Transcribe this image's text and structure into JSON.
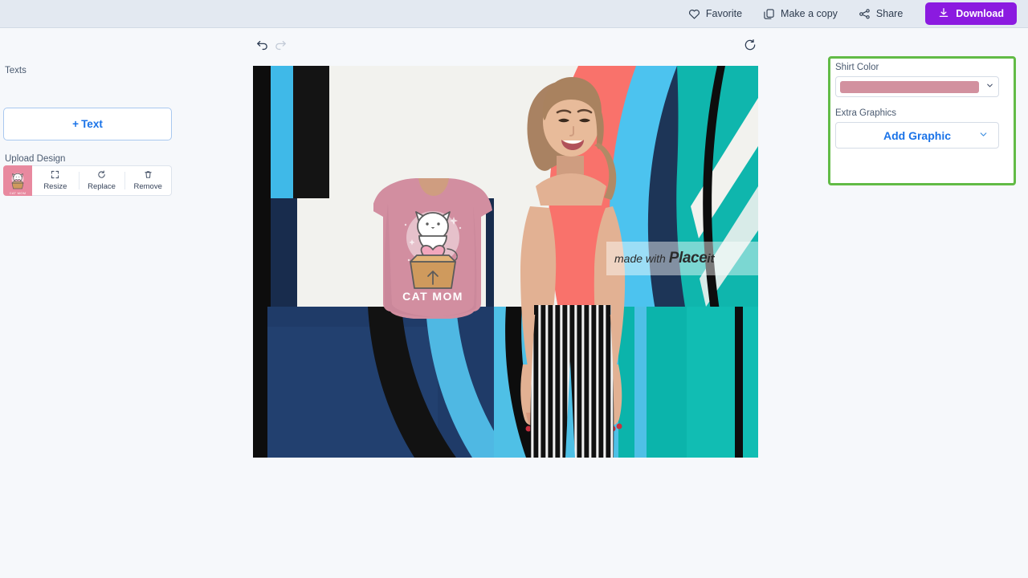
{
  "topbar": {
    "actions": [
      {
        "label": "Favorite",
        "icon": "heart-icon"
      },
      {
        "label": "Make a copy",
        "icon": "copy-icon"
      },
      {
        "label": "Share",
        "icon": "share-icon"
      }
    ],
    "download_label": "Download",
    "download_icon": "download-icon",
    "download_color": "#8b1ae0",
    "background": "#e3e9f1"
  },
  "toolbar": {
    "undo_icon": "undo-icon",
    "redo_icon": "redo-icon",
    "refresh_icon": "refresh-icon",
    "undo_enabled": true,
    "redo_enabled": false
  },
  "sidebar": {
    "texts_label": "Texts",
    "add_text_label": "Text",
    "add_text_plus": "+",
    "upload_design_label": "Upload Design",
    "thumbnail_caption": "CAT MOM",
    "upload_actions": [
      {
        "label": "Resize",
        "icon": "resize-icon"
      },
      {
        "label": "Replace",
        "icon": "replace-icon"
      },
      {
        "label": "Remove",
        "icon": "trash-icon"
      }
    ]
  },
  "canvas": {
    "watermark_prefix": "made with",
    "watermark_brand": "Place",
    "watermark_brand_suffix": "it",
    "shirt_text": "CAT MOM",
    "shirt_color": "#d28ea0",
    "mural_colors": [
      "#1d3557",
      "#3fb9e8",
      "#0fb6ad",
      "#f9726b",
      "#ffffff",
      "#111111"
    ]
  },
  "right_panel": {
    "highlight_color": "#62bb46",
    "shirt_color_label": "Shirt Color",
    "shirt_color_value": "#d2919f",
    "extra_graphics_label": "Extra Graphics",
    "add_graphic_label": "Add Graphic",
    "chevron_icon": "chevron-down-icon"
  }
}
